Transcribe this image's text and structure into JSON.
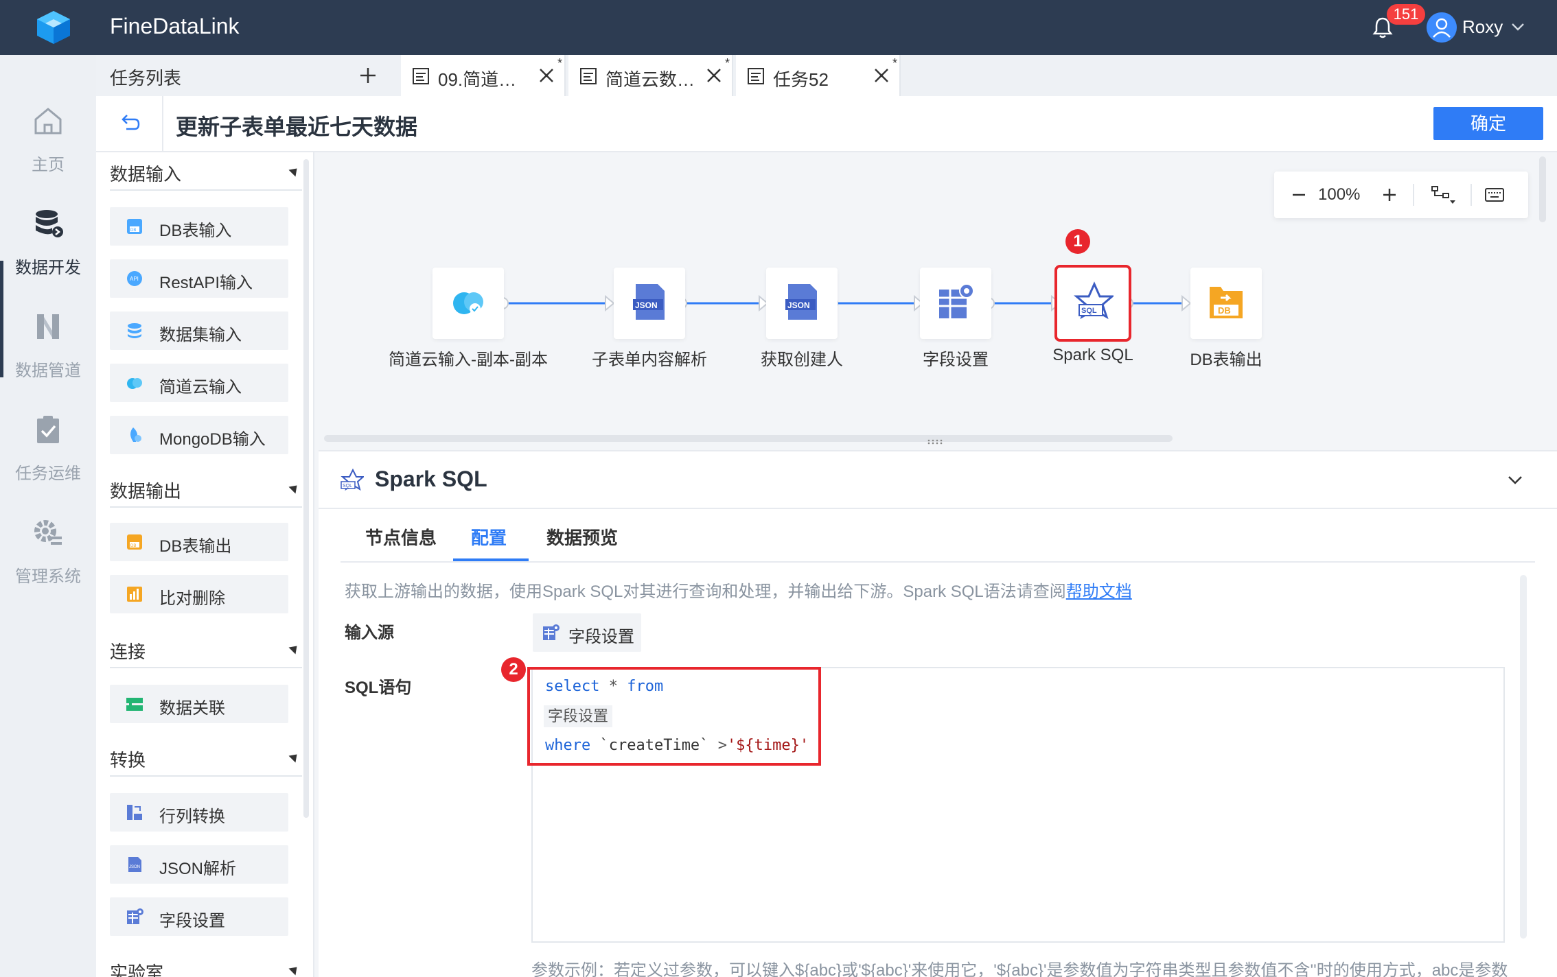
{
  "header": {
    "brand": "FineDataLink",
    "notification_count": "151",
    "username": "Roxy"
  },
  "rail": {
    "items": [
      {
        "label": "主页",
        "icon": "home-icon"
      },
      {
        "label": "数据开发",
        "icon": "database-icon",
        "active": true
      },
      {
        "label": "数据管道",
        "icon": "pipeline-icon"
      },
      {
        "label": "任务运维",
        "icon": "task-check-icon"
      },
      {
        "label": "管理系统",
        "icon": "gear-icon"
      }
    ]
  },
  "tabs": {
    "task_list_label": "任务列表",
    "items": [
      {
        "title": "09.简道云…",
        "modified": "*"
      },
      {
        "title": "简道云数…",
        "modified": "*"
      },
      {
        "title": "任务52",
        "modified": "*"
      }
    ]
  },
  "titlebar": {
    "title": "更新子表单最近七天数据",
    "confirm_label": "确定"
  },
  "palette": {
    "sections": [
      {
        "title": "数据输入",
        "items": [
          "DB表输入",
          "RestAPI输入",
          "数据集输入",
          "简道云输入",
          "MongoDB输入"
        ]
      },
      {
        "title": "数据输出",
        "items": [
          "DB表输出",
          "比对删除"
        ]
      },
      {
        "title": "连接",
        "items": [
          "数据关联"
        ]
      },
      {
        "title": "转换",
        "items": [
          "行列转换",
          "JSON解析",
          "字段设置"
        ]
      },
      {
        "title": "实验室",
        "items": []
      }
    ]
  },
  "canvas": {
    "zoom": "100%",
    "nodes": [
      {
        "label": "简道云输入-副本-副本",
        "icon": "cloud-icon"
      },
      {
        "label": "子表单内容解析",
        "icon": "json-icon"
      },
      {
        "label": "获取创建人",
        "icon": "json-icon"
      },
      {
        "label": "字段设置",
        "icon": "field-settings-icon"
      },
      {
        "label": "Spark SQL",
        "icon": "spark-sql-icon",
        "selected": true
      },
      {
        "label": "DB表输出",
        "icon": "db-output-icon"
      }
    ],
    "markers": [
      "1",
      "2"
    ]
  },
  "panel": {
    "title": "Spark SQL",
    "tabs": [
      "节点信息",
      "配置",
      "数据预览"
    ],
    "active_tab": "配置",
    "description": "获取上游输出的数据，使用Spark SQL对其进行查询和处理，并输出给下游。Spark SQL语法请查阅",
    "help_link": "帮助文档",
    "input_source_label": "输入源",
    "input_source_value": "字段设置",
    "sql_label": "SQL语句",
    "sql": {
      "select": "select",
      "star": "*",
      "from": "from",
      "table_chip": "字段设置",
      "where": "where",
      "column": "`createTime`",
      "operator": ">",
      "value": "'${time}'"
    },
    "hint": "参数示例：若定义过参数，可以键入${abc}或'${abc}'来使用它，'${abc}'是参数值为字符串类型且参数值不含''时的使用方式，abc是参数"
  },
  "colors": {
    "header_bg": "#2d3c52",
    "accent": "#2f7cf6",
    "highlight": "#e8262d"
  }
}
